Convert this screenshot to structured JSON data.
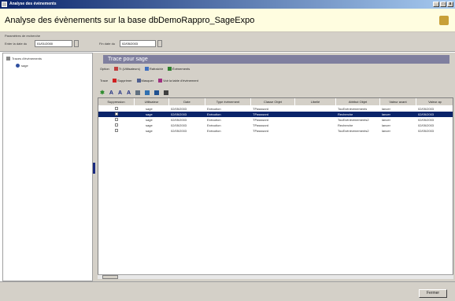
{
  "window": {
    "title": "Analyse des évènements",
    "min": "_",
    "max": "□",
    "close": "x"
  },
  "header": {
    "title": "Analyse des évènements sur la base dbDemoRappro_SageExpo"
  },
  "params": {
    "section_label": "Paramètres de recherche",
    "from_label": "Enter la date du",
    "from_value": "01/01/2000",
    "to_label": "Fin date du",
    "to_value": "02/05/2003"
  },
  "tree": {
    "root": "Traces d'évènements",
    "child": "sage"
  },
  "panel": {
    "title": "Trace pour sage",
    "toolbar1": {
      "options": "Option",
      "filter": "Tt (Utilisateurs)",
      "refresh": "Rafraichir",
      "events": "Évènements"
    },
    "toolbar2": {
      "trace": "Trace",
      "delete": "Supprimer",
      "hide": "Masquer",
      "view": "Voir la table d'évènement"
    },
    "toolbar3": [
      "A",
      "A",
      "A"
    ]
  },
  "grid": {
    "columns": [
      "Suppression",
      "Utilisateur",
      "Date",
      "Type évènement",
      "Classe Objet",
      "Libellé",
      "Attribut Objet",
      "Valeur avant",
      "Valeur ap"
    ],
    "rows": [
      {
        "user": "sage",
        "date": "02/05/2003",
        "type": "Exécution",
        "class": "TPassword",
        "label": "",
        "attr": "TouEvénèvenements",
        "before": "lancer",
        "after": "02/05/2003"
      },
      {
        "user": "sage",
        "date": "02/05/2003",
        "type": "Exécution",
        "class": "TPassword",
        "label": "",
        "attr": "Recherche",
        "before": "lancer",
        "after": "02/05/2003"
      },
      {
        "user": "sage",
        "date": "02/05/2003",
        "type": "Exécution",
        "class": "TPassword",
        "label": "",
        "attr": "TouEvénèvenements2",
        "before": "lancer",
        "after": "02/05/2003"
      },
      {
        "user": "sage",
        "date": "02/05/2003",
        "type": "Exécution",
        "class": "TPassword",
        "label": "",
        "attr": "Recherche",
        "before": "lancer",
        "after": "02/05/2003"
      },
      {
        "user": "sage",
        "date": "02/05/2003",
        "type": "Exécution",
        "class": "TPassword",
        "label": "",
        "attr": "TouEvénèvenements2",
        "before": "lancer",
        "after": "02/05/2003"
      }
    ]
  },
  "status": {
    "button": "Fermer"
  }
}
